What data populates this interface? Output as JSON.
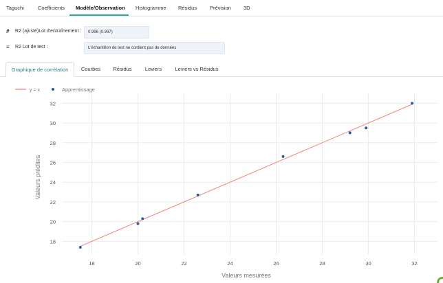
{
  "nav": {
    "tabs": [
      {
        "label": "Taguchi"
      },
      {
        "label": "Coefficients"
      },
      {
        "label": "Modèle/Observation"
      },
      {
        "label": "Histogramme"
      },
      {
        "label": "Résidus"
      },
      {
        "label": "Prévision"
      },
      {
        "label": "3D"
      }
    ],
    "active": "Modèle/Observation"
  },
  "stats": {
    "r2_train": {
      "icon": "#",
      "label": "R2 (ajusté)Lot d'entraînement :",
      "value": "0.996 (0.997)"
    },
    "r2_test": {
      "icon": "≡",
      "label": "R2 Lot de test :",
      "value": "L'échantillon de test ne contient pas de données"
    }
  },
  "subtabs": {
    "items": [
      {
        "label": "Graphique de corrélation"
      },
      {
        "label": "Courbes"
      },
      {
        "label": "Résidus"
      },
      {
        "label": "Leviers"
      },
      {
        "label": "Leviers vs Résidus"
      }
    ],
    "active": "Graphique de corrélation"
  },
  "colors": {
    "accent": "#2aa8a0",
    "line": "#f0796b",
    "points": "#2c5aa0"
  },
  "chart_data": {
    "type": "scatter",
    "xlabel": "Valeurs mesurées",
    "ylabel": "Valeurs prédites",
    "xlim": [
      16.7,
      33.0
    ],
    "ylim": [
      16.7,
      33.0
    ],
    "x_ticks": [
      18,
      20,
      22,
      24,
      26,
      28,
      30,
      32
    ],
    "y_ticks": [
      18,
      20,
      22,
      24,
      26,
      28,
      30,
      32
    ],
    "grid": true,
    "legend_position": "top-left",
    "series": [
      {
        "name": "y = x",
        "kind": "line",
        "x": [
          17.5,
          31.9
        ],
        "y": [
          17.5,
          31.9
        ]
      },
      {
        "name": "Apprentissage",
        "kind": "points",
        "x": [
          17.5,
          20.0,
          20.2,
          22.6,
          26.3,
          29.2,
          29.9,
          31.9
        ],
        "y": [
          17.4,
          19.8,
          20.3,
          22.7,
          26.6,
          29.0,
          29.5,
          32.0
        ]
      }
    ]
  }
}
